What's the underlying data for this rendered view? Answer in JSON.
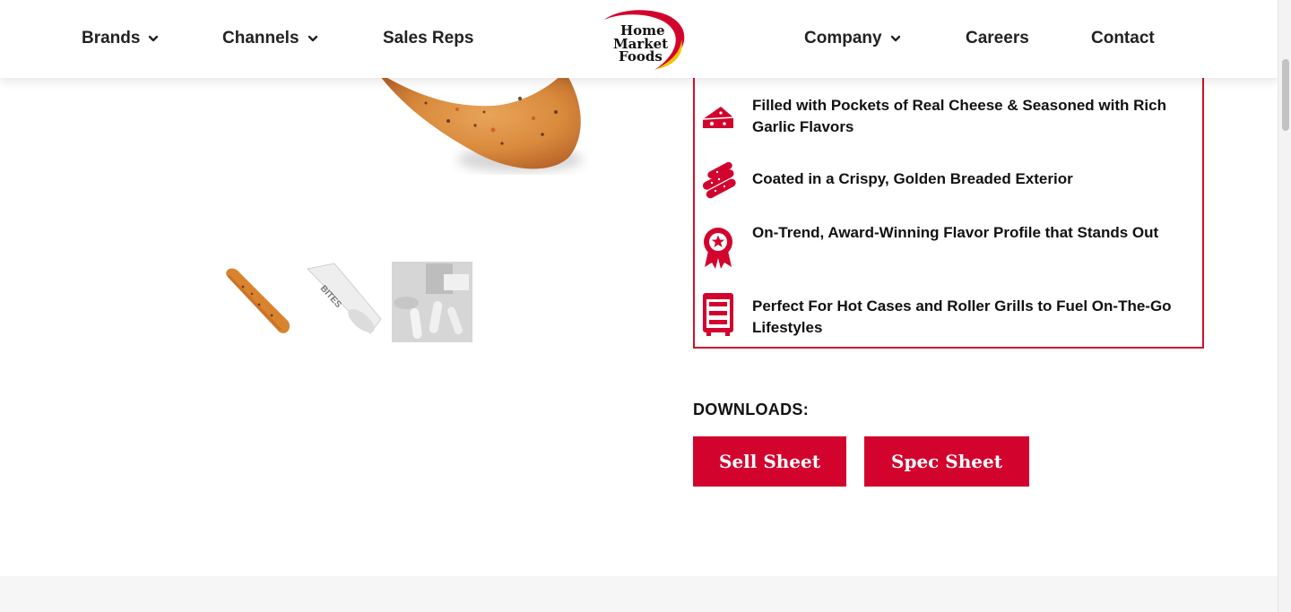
{
  "nav": {
    "left": [
      {
        "label": "Brands",
        "dropdown": true
      },
      {
        "label": "Channels",
        "dropdown": true
      },
      {
        "label": "Sales Reps",
        "dropdown": false
      }
    ],
    "right": [
      {
        "label": "Company",
        "dropdown": true
      },
      {
        "label": "Careers",
        "dropdown": false
      },
      {
        "label": "Contact",
        "dropdown": false
      }
    ],
    "logo": {
      "line1": "Home",
      "line2": "Market",
      "line3": "Foods"
    }
  },
  "features": [
    {
      "icon": "cheese-icon",
      "text": "Filled with Pockets of Real Cheese & Seasoned with Rich Garlic Flavors"
    },
    {
      "icon": "breadstick-icon",
      "text": "Coated in a Crispy, Golden Breaded Exterior"
    },
    {
      "icon": "award-ribbon-icon",
      "text": "On-Trend, Award-Winning Flavor Profile that Stands Out"
    },
    {
      "icon": "hot-case-icon",
      "text": "Perfect For Hot Cases and Roller Grills to Fuel On-The-Go Lifestyles"
    }
  ],
  "downloads": {
    "label": "DOWNLOADS:",
    "buttons": [
      {
        "label": "Sell Sheet"
      },
      {
        "label": "Spec Sheet"
      }
    ]
  },
  "thumbnails": [
    {
      "name": "product-thumbnail-stick"
    },
    {
      "name": "product-thumbnail-package",
      "package_text": "BITES"
    },
    {
      "name": "product-thumbnail-serving"
    }
  ],
  "colors": {
    "accent": "#d2042d",
    "logo_yellow": "#f6c500",
    "text": "#111111"
  }
}
